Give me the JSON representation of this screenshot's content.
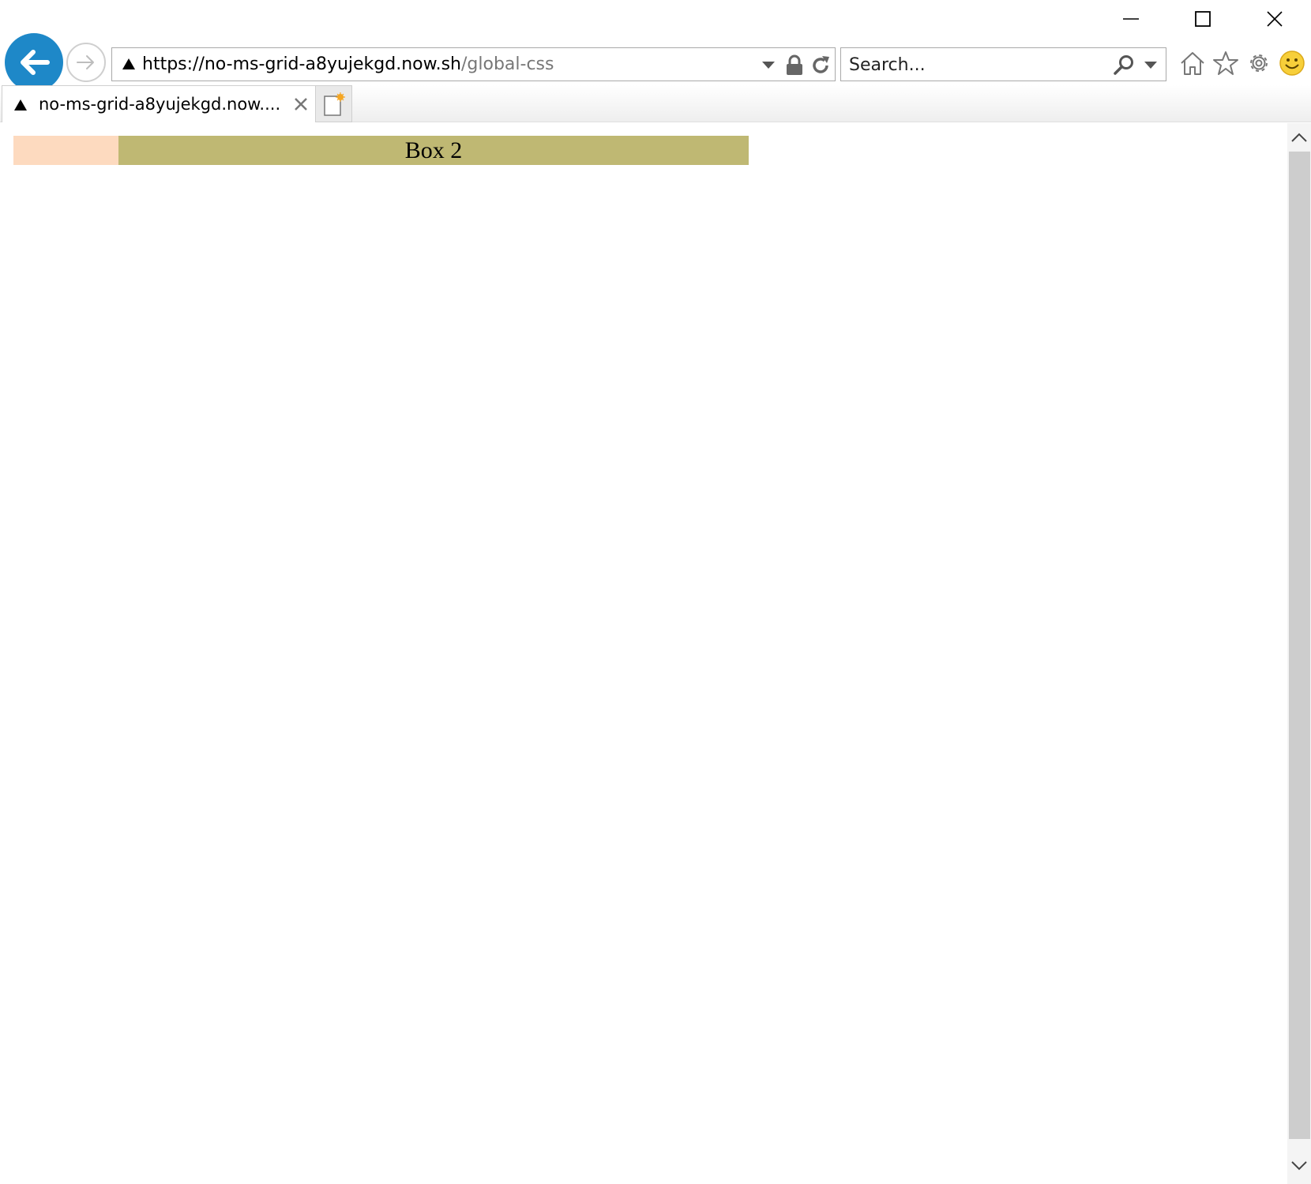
{
  "browser": {
    "address": {
      "url_main": "https://no-ms-grid-a8yujekgd.now.sh",
      "url_path": "/global-css"
    },
    "search": {
      "placeholder": "Search..."
    },
    "tab": {
      "title": "no-ms-grid-a8yujekgd.now...."
    },
    "colors": {
      "back_button": "#1e88c8",
      "box_1": "#fddabf",
      "box_2": "#bfb873",
      "scroll_thumb": "#cdcdcd"
    },
    "icons": [
      "minimize-icon",
      "maximize-icon",
      "close-icon",
      "back-arrow-icon",
      "forward-arrow-icon",
      "site-triangle-icon",
      "chevron-down-icon",
      "lock-icon",
      "refresh-icon",
      "search-icon",
      "home-icon",
      "star-icon",
      "gear-icon",
      "smiley-icon",
      "tab-close-icon",
      "new-tab-icon",
      "scroll-up-icon",
      "scroll-down-icon"
    ]
  },
  "page": {
    "box_2_label": "Box 2"
  }
}
